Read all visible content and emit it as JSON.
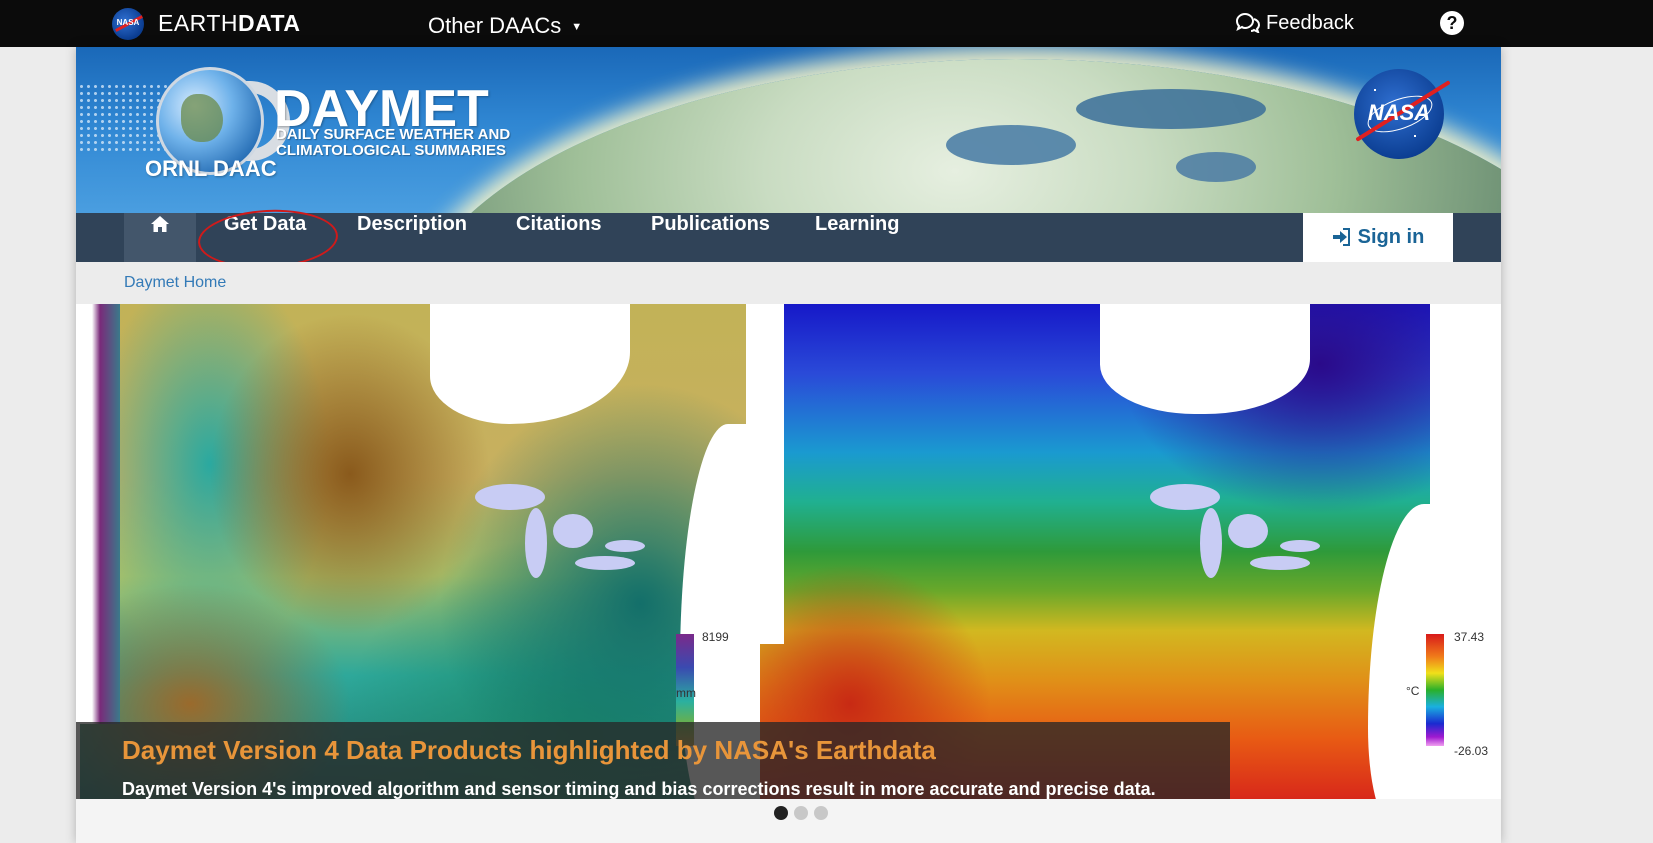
{
  "topbar": {
    "logo_badge": "NASA",
    "logo_text_light": "EARTH",
    "logo_text_bold": "DATA",
    "other_daacs_label": "Other DAACs",
    "feedback_label": "Feedback",
    "help_label": "?",
    "icons": {
      "caret": "caret-down-icon",
      "feedback": "chat-bubbles-icon",
      "help": "question-circle-icon"
    }
  },
  "banner": {
    "title": "DAYMET",
    "subtitle_line1": "DAILY SURFACE WEATHER AND",
    "subtitle_line2": "CLIMATOLOGICAL SUMMARIES",
    "org": "ORNL DAAC",
    "agency_logo": "NASA"
  },
  "nav": {
    "home_icon": "home-icon",
    "items": [
      {
        "label": "Get Data"
      },
      {
        "label": "Description"
      },
      {
        "label": "Citations"
      },
      {
        "label": "Publications"
      },
      {
        "label": "Learning"
      }
    ],
    "signin_label": "Sign in",
    "signin_icon": "sign-in-icon",
    "highlight_color": "#d01a1a"
  },
  "breadcrumb": {
    "home": "Daymet Home"
  },
  "carousel": {
    "slide_title": "Daymet Version 4 Data Products highlighted by NASA's Earthdata",
    "slide_text": "Daymet Version 4's improved algorithm and sensor timing and bias corrections result in more accurate and precise data.",
    "legend_precip": {
      "max": "8199",
      "unit": "mm"
    },
    "legend_temp": {
      "max": "37.43",
      "min": "-26.03",
      "unit": "°C"
    },
    "indicator_count": 3,
    "active_index": 0
  },
  "colors": {
    "topbar_bg": "#0b0b0b",
    "nav_bg": "#304358",
    "link": "#337ab7",
    "caption_title": "#e8953a"
  }
}
